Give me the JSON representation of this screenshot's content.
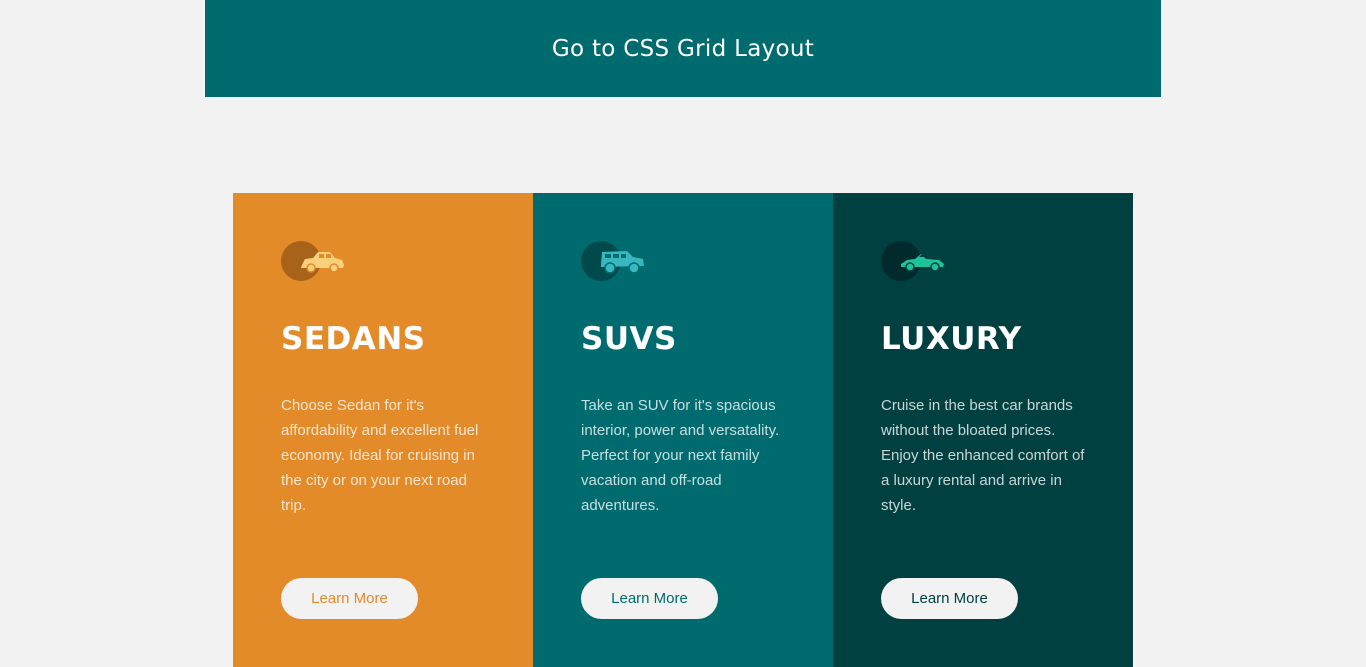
{
  "header": {
    "link_label": "Go to CSS Grid Layout",
    "background": "#006b6e"
  },
  "cards": [
    {
      "title": "SEDANS",
      "description": "Choose Sedan for it's affordability and excellent fuel economy. Ideal for cruising in the city or on your next road trip.",
      "button_label": "Learn More",
      "icon": "sedan-car-icon",
      "background": "#e38a29",
      "accent": "#e38a29"
    },
    {
      "title": "SUVS",
      "description": "Take an SUV for it's spacious interior, power and versatality. Perfect for your next family vacation and off-road adventures.",
      "button_label": "Learn More",
      "icon": "suv-car-icon",
      "background": "#006b6e",
      "accent": "#006b6e"
    },
    {
      "title": "LUXURY",
      "description": "Cruise in the best car brands without the bloated prices. Enjoy the enhanced comfort of a luxury rental and arrive in style.",
      "button_label": "Learn More",
      "icon": "luxury-car-icon",
      "background": "#004041",
      "accent": "#004041"
    }
  ]
}
